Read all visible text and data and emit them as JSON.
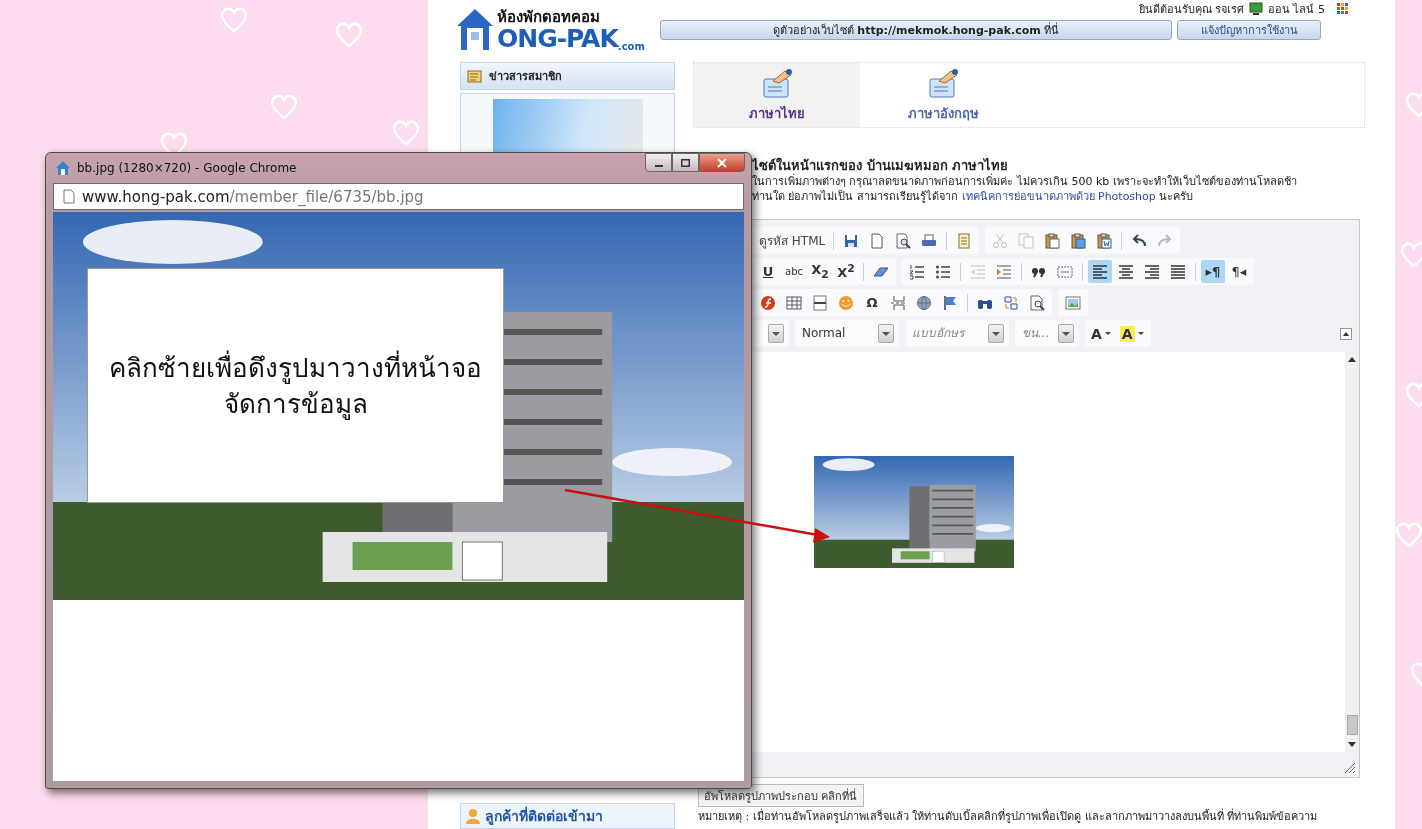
{
  "header": {
    "logo": {
      "thai_name": "ห้องพักดอทคอม",
      "brand": "ONG-PAK",
      "suffix": ".com"
    },
    "welcome": "ยินดีต้อนรับคุณ รจเรศ",
    "online": "ออน ไลน์ 5",
    "buttons": [
      {
        "label": "ดูตัวอย่างเว็บไซต์ **http://mekmok.hong-pak.com** ที่นี่"
      },
      {
        "label": "แจ้งปัญหาการใช้งาน"
      }
    ]
  },
  "sidebar": {
    "news_title": "ข่าวสารสมาชิก",
    "contacts_title": "ลูกค้าที่ติดต่อเข้ามา"
  },
  "language_tabs": [
    {
      "label": "ภาษาไทย",
      "selected": true
    },
    {
      "label": "ภาษาอังกฤษ",
      "selected": false
    }
  ],
  "instructions": {
    "heading": "ไซต์ในหน้าแรกของ บ้านเมฆหมอก ภาษาไทย",
    "line_1": "ในการเพิ่มภาพต่างๆ กรุณาลดขนาดภาพก่อนการเพิ่มค่ะ ไม่ควรเกิน 500 kb เพราะจะทำให้เว็บไซต์ของท่านโหลดช้า",
    "line_2": "ท่านใด ย่อภาพไม่เป็น สามารถเรียนรู้ได้จาก",
    "link": "เทคนิคการย่อขนาดภาพด้วย Photoshop",
    "line_2_end": "นะครับ"
  },
  "editor": {
    "toolbar": [
      [
        [
          {
            "kind": "source",
            "text": "ดูรหัส HTML",
            "disabled": false,
            "selected": false
          },
          {
            "kind": "sep"
          },
          {
            "kind": "save",
            "disabled": false,
            "selected": false
          },
          {
            "kind": "newpage",
            "disabled": false,
            "selected": false
          },
          {
            "kind": "preview",
            "disabled": false,
            "selected": false
          },
          {
            "kind": "print",
            "disabled": false,
            "selected": false
          },
          {
            "kind": "sep"
          },
          {
            "kind": "templates",
            "disabled": false,
            "selected": false
          }
        ],
        [
          {
            "kind": "cut",
            "disabled": true,
            "selected": false
          },
          {
            "kind": "copy",
            "disabled": true,
            "selected": false
          },
          {
            "kind": "paste",
            "disabled": false,
            "selected": false
          },
          {
            "kind": "paste_text",
            "disabled": false,
            "selected": false
          },
          {
            "kind": "paste_word",
            "disabled": false,
            "selected": false
          },
          {
            "kind": "sep"
          },
          {
            "kind": "undo",
            "disabled": false,
            "selected": false
          },
          {
            "kind": "redo",
            "disabled": true,
            "selected": false
          }
        ]
      ],
      [
        [
          {
            "kind": "underline",
            "text": "U",
            "disabled": false,
            "selected": false
          },
          {
            "kind": "strike",
            "text": "abc",
            "disabled": false,
            "selected": false
          },
          {
            "kind": "subscript",
            "text": "X$_{2}$",
            "disabled": false,
            "selected": false
          },
          {
            "kind": "superscript",
            "text": "X$^{2}$",
            "disabled": false,
            "selected": false
          },
          {
            "kind": "sep"
          },
          {
            "kind": "eraser",
            "disabled": false,
            "selected": false
          }
        ],
        [
          {
            "kind": "ol",
            "disabled": false,
            "selected": false
          },
          {
            "kind": "ul",
            "disabled": false,
            "selected": false
          },
          {
            "kind": "sep"
          },
          {
            "kind": "outdent",
            "disabled": true,
            "selected": false
          },
          {
            "kind": "indent",
            "disabled": false,
            "selected": false
          },
          {
            "kind": "sep"
          },
          {
            "kind": "blockquote",
            "disabled": false,
            "selected": false
          },
          {
            "kind": "div",
            "disabled": false,
            "selected": false
          },
          {
            "kind": "sep"
          },
          {
            "kind": "align_left",
            "disabled": false,
            "selected": true
          },
          {
            "kind": "align_center",
            "disabled": false,
            "selected": false
          },
          {
            "kind": "align_right",
            "disabled": false,
            "selected": false
          },
          {
            "kind": "justify",
            "disabled": false,
            "selected": false
          },
          {
            "kind": "sep"
          },
          {
            "kind": "ltr",
            "text": "▸¶",
            "disabled": false,
            "selected": true
          },
          {
            "kind": "rtl",
            "text": "¶◂",
            "disabled": false,
            "selected": false
          }
        ]
      ],
      [
        [
          {
            "kind": "flash",
            "disabled": false,
            "selected": false
          },
          {
            "kind": "table",
            "disabled": false,
            "selected": false
          },
          {
            "kind": "hr",
            "disabled": false,
            "selected": false
          },
          {
            "kind": "smiley",
            "disabled": false,
            "selected": false
          },
          {
            "kind": "special_char",
            "text": "Ω",
            "disabled": false,
            "selected": false
          },
          {
            "kind": "pagebreak",
            "disabled": false,
            "selected": false
          },
          {
            "kind": "iframe",
            "disabled": false,
            "selected": false
          },
          {
            "kind": "anchor",
            "disabled": false,
            "selected": false
          },
          {
            "kind": "sep"
          },
          {
            "kind": "find",
            "disabled": false,
            "selected": false
          },
          {
            "kind": "replace",
            "disabled": false,
            "selected": false
          },
          {
            "kind": "selectall",
            "disabled": false,
            "selected": false
          }
        ],
        [
          {
            "kind": "image",
            "disabled": false,
            "selected": false
          }
        ]
      ],
      [
        [
          {
            "kind": "combo"
          }
        ],
        [
          {
            "kind": "combo",
            "value": "Normal"
          }
        ],
        [
          {
            "kind": "combo",
            "placeholder": "แบบอักษร"
          }
        ],
        [
          {
            "kind": "combo",
            "placeholder": "ขน..."
          }
        ],
        [
          {
            "kind": "text_color",
            "text": "A",
            "disabled": false,
            "selected": false
          },
          {
            "kind": "bg_color",
            "text": "A",
            "disabled": false,
            "selected": false
          }
        ]
      ]
    ]
  },
  "upload_button": "อัพโหลดรูปภาพประกอบ คลิกที่นี่",
  "note": "หมายเหตุ : เมื่อท่านอัพโหลดรูปภาพเสร็จแล้ว ให้ท่านดับเบิ้ลคลิกที่รูปภาพเพื่อเปิดดู และลากภาพมาวางลงบนพื้นที่ ที่ท่านพิมพ์ข้อความ",
  "popup": {
    "title": "bb.jpg (1280×720) - Google Chrome",
    "url_host": "www.hong-pak.com",
    "url_path": "/member_file/6735/bb.jpg",
    "callout": "คลิกซ้ายเพื่อดึงรูปมาวางที่หน้าจอจัดการข้อมูล"
  }
}
